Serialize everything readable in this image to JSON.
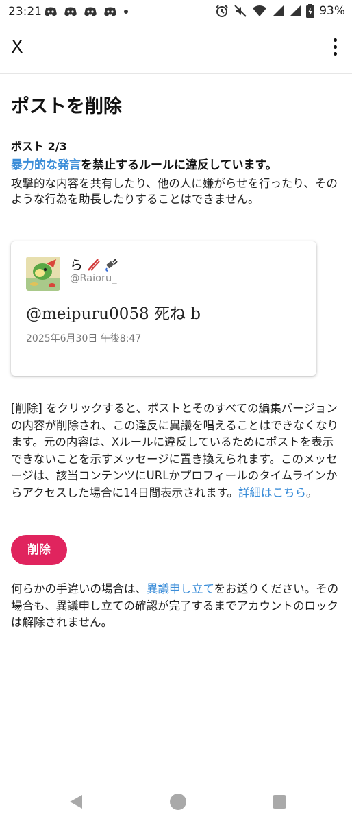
{
  "status_bar": {
    "time": "23:21",
    "battery_percent": "93%",
    "notification_icons": [
      "discord-icon",
      "discord-icon",
      "discord-icon",
      "discord-icon",
      "dot-icon"
    ],
    "system_icons": [
      "alarm-icon",
      "mute-icon",
      "wifi-icon",
      "signal-icon",
      "signal-icon",
      "battery-charging-icon"
    ]
  },
  "app_bar": {
    "close_label": "X",
    "more_icon": "more-vertical-icon"
  },
  "main": {
    "title": "ポストを削除",
    "post_counter": "ポスト 2/3",
    "rule_link": "暴力的な発言",
    "rule_text": "を禁止するルールに違反しています。",
    "description": "攻撃的な内容を共有したり、他の人に嫌がらせを行ったり、そのような行為を助長したりすることはできません。"
  },
  "post": {
    "display_name": "ら",
    "name_emojis": [
      "slash-icon",
      "plug-icon"
    ],
    "handle": "@Raioru_",
    "text": "@meipuru0058 死ね b",
    "date": "2025年6月30日 午後8:47"
  },
  "info": {
    "text": "[削除] をクリックすると、ポストとそのすべての編集バージョンの内容が削除され、この違反に異議を唱えることはできなくなります。元の内容は、Xルールに違反しているためにポストを表示できないことを示すメッセージに置き換えられます。このメッセージは、該当コンテンツにURLかプロフィールのタイムラインからアクセスした場合に14日間表示されます。",
    "learn_more_link": "詳細はこちら",
    "end": "。"
  },
  "delete_button": {
    "label": "削除",
    "color": "#e0245e"
  },
  "footer": {
    "before": "何らかの手違いの場合は、",
    "appeal_link": "異議申し立て",
    "after": "をお送りください。その場合も、異議申し立ての確認が完了するまでアカウントのロックは解除されません。"
  },
  "colors": {
    "link": "#3b8dd8",
    "accent": "#e0245e",
    "text": "#222222",
    "muted": "#888888"
  }
}
